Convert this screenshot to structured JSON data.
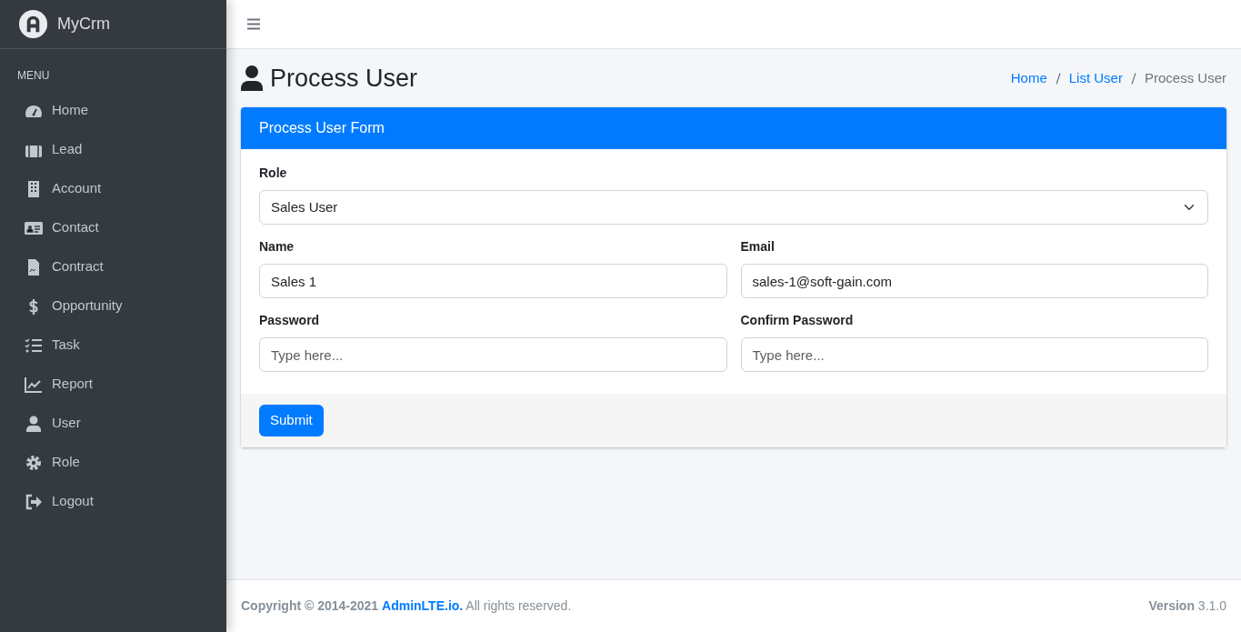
{
  "brand": {
    "name": "MyCrm"
  },
  "sidebar": {
    "header": "MENU",
    "items": [
      {
        "label": "Home",
        "selected": false
      },
      {
        "label": "Lead",
        "selected": false
      },
      {
        "label": "Account",
        "selected": false
      },
      {
        "label": "Contact",
        "selected": false
      },
      {
        "label": "Contract",
        "selected": false
      },
      {
        "label": "Opportunity",
        "selected": false
      },
      {
        "label": "Task",
        "selected": false
      },
      {
        "label": "Report",
        "selected": false
      },
      {
        "label": "User",
        "selected": false
      },
      {
        "label": "Role",
        "selected": false
      },
      {
        "label": "Logout",
        "selected": false
      }
    ]
  },
  "page": {
    "title": "Process User",
    "breadcrumb": [
      {
        "label": "Home",
        "kind": "link"
      },
      {
        "label": "List User",
        "kind": "link"
      },
      {
        "label": "Process User",
        "kind": "current"
      }
    ]
  },
  "card": {
    "title": "Process User Form",
    "fields": [
      {
        "label": "Role",
        "kind": "select",
        "value": "Sales User"
      },
      {
        "label": "Name",
        "kind": "text",
        "value": "Sales 1"
      },
      {
        "label": "Email",
        "kind": "text",
        "value": "sales-1@soft-gain.com"
      },
      {
        "label": "Password",
        "kind": "password",
        "placeholder": "Type here..."
      },
      {
        "label": "Confirm Password",
        "kind": "password",
        "placeholder": "Type here..."
      }
    ],
    "submit": "Submit"
  },
  "footer": {
    "copyright": "Copyright © 2014-2021",
    "link": "AdminLTE.io.",
    "suffix": "All rights reserved.",
    "version": "**Version** 3.1.0"
  }
}
